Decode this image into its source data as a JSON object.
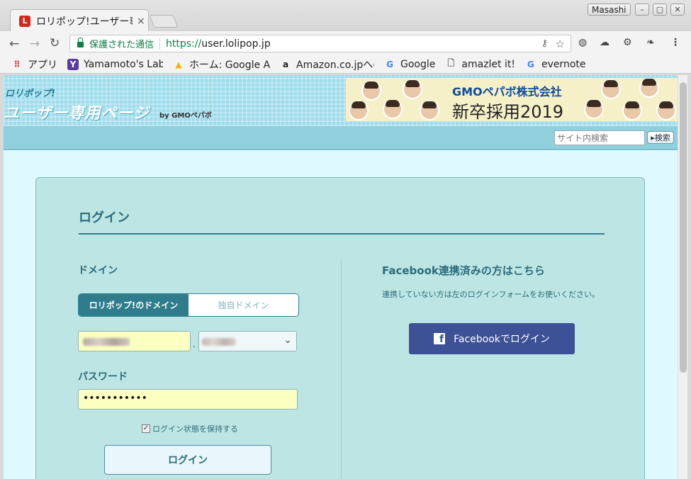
{
  "browser": {
    "tab_title": "ロリポップ!ユーザー専用ページ",
    "tab_close": "×",
    "profile_name": "Masashi",
    "security_label": "保護された通信",
    "url_scheme": "https://",
    "url_host": "user.lolipop.jp",
    "nav": {
      "back": "←",
      "forward": "→",
      "reload": "↻"
    },
    "window_controls": {
      "minimize": "–",
      "maximize": "▢",
      "close": "✕"
    }
  },
  "bookmarks": [
    {
      "label": "アプリ",
      "icon": "apps-grid-icon"
    },
    {
      "label": "Yamamoto's Lab",
      "icon": "yamamoto-lab-icon"
    },
    {
      "label": "ホーム: Google AdSense",
      "icon": "adsense-icon"
    },
    {
      "label": "Amazon.co.jpへのリンク",
      "icon": "amazon-icon"
    },
    {
      "label": "Google",
      "icon": "google-icon"
    },
    {
      "label": "amazlet it!",
      "icon": "page-icon"
    },
    {
      "label": "evernote",
      "icon": "google-icon"
    }
  ],
  "site": {
    "logo_top": "ロリポップ!",
    "logo_main": "ユーザー専用ページ",
    "logo_by": "by GMOペパボ",
    "banner_company": "GMOペパボ株式会社",
    "banner_recruit": "新卒採用2019",
    "search_placeholder": "サイト内検索",
    "search_button": "検索"
  },
  "login": {
    "title": "ログイン",
    "domain_label": "ドメイン",
    "domain_tabs": {
      "lolipop": "ロリポップ!のドメイン",
      "own": "独自ドメイン"
    },
    "domain_separator": ".",
    "password_label": "パスワード",
    "password_mask": "•••••••••••",
    "remember_label": "ログイン状態を保持する",
    "remember_checked": true,
    "submit": "ログイン"
  },
  "facebook": {
    "title": "Facebook連携済みの方はこちら",
    "description": "連携していない方は左のログインフォームをお使いください。",
    "button": "Facebookでログイン",
    "brand_color": "#3c5196"
  }
}
